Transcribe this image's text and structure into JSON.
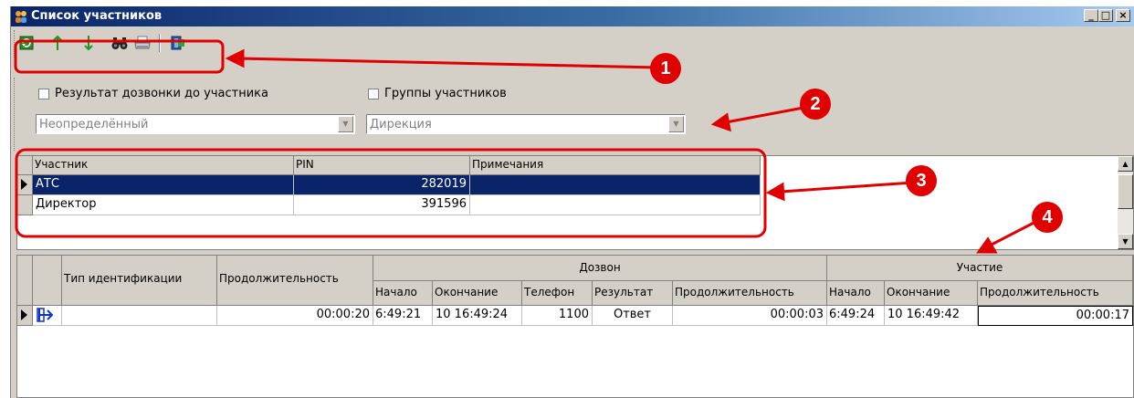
{
  "window": {
    "title": "Список участников",
    "controls": [
      "_",
      "□",
      "×"
    ]
  },
  "toolbar": {
    "buttons": [
      {
        "name": "refresh-icon"
      },
      {
        "name": "arrow-up-icon"
      },
      {
        "name": "arrow-down-icon"
      },
      {
        "name": "binoculars-icon"
      },
      {
        "name": "printer-icon"
      },
      {
        "name": "exit-icon"
      }
    ]
  },
  "filters": {
    "dial_result": {
      "label": "Результат дозвонки до участника",
      "checked": false,
      "value": "Неопределённый"
    },
    "groups": {
      "label": "Группы участников",
      "checked": false,
      "value": "Дирекция"
    }
  },
  "participants": {
    "headers": [
      "Участник",
      "PIN",
      "Примечания"
    ],
    "rows": [
      {
        "name": "АТС",
        "pin": "282019",
        "note": "",
        "selected": true
      },
      {
        "name": "Директор",
        "pin": "391596",
        "note": "",
        "selected": false
      }
    ]
  },
  "calls": {
    "headers": {
      "type": "Тип идентификации",
      "duration": "Продолжительность",
      "dial_group": "Дозвон",
      "dial": [
        "Начало",
        "Окончание",
        "Телефон",
        "Результат",
        "Продолжительность"
      ],
      "part_group": "Участие",
      "part": [
        "Начало",
        "Окончание",
        "Продолжительность"
      ]
    },
    "rows": [
      {
        "type": "",
        "duration": "00:00:20",
        "dial": [
          "6:49:21",
          "10 16:49:24",
          "1100",
          "Ответ",
          "00:00:03"
        ],
        "part": [
          "6:49:24",
          "10 16:49:42",
          "00:00:17"
        ]
      }
    ]
  },
  "annotations": [
    "1",
    "2",
    "3",
    "4"
  ],
  "colors": {
    "selection": "#0a246a",
    "annotation": "#e00000",
    "face": "#d4d0c8"
  }
}
